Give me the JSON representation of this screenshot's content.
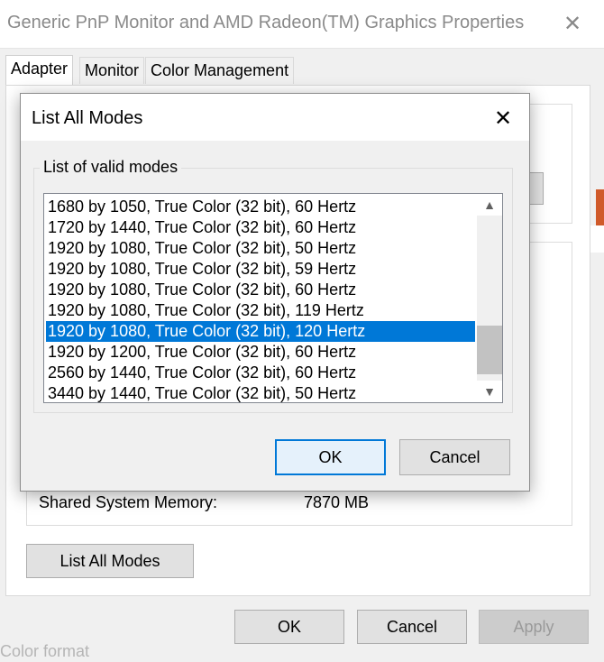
{
  "window": {
    "title": "Generic PnP Monitor and AMD Radeon(TM) Graphics Properties",
    "close_icon": "close-icon"
  },
  "tabs": [
    {
      "label": "Adapter",
      "active": true
    },
    {
      "label": "Monitor",
      "active": false
    },
    {
      "label": "Color Management",
      "active": false
    }
  ],
  "adapter": {
    "shared_memory_label": "Shared System Memory:",
    "shared_memory_value": "7870 MB",
    "list_all_modes_label": "List All Modes"
  },
  "footer": {
    "ok_label": "OK",
    "cancel_label": "Cancel",
    "apply_label": "Apply",
    "apply_enabled": false
  },
  "background_cutoff_text": "Color format",
  "dialog": {
    "title": "List All Modes",
    "group_label": "List of valid modes",
    "modes": [
      "1680 by 1050, True Color (32 bit), 60 Hertz",
      "1720 by 1440, True Color (32 bit), 60 Hertz",
      "1920 by 1080, True Color (32 bit), 50 Hertz",
      "1920 by 1080, True Color (32 bit), 59 Hertz",
      "1920 by 1080, True Color (32 bit), 60 Hertz",
      "1920 by 1080, True Color (32 bit), 119 Hertz",
      "1920 by 1080, True Color (32 bit), 120 Hertz",
      "1920 by 1200, True Color (32 bit), 60 Hertz",
      "2560 by 1440, True Color (32 bit), 60 Hertz",
      "3440 by 1440, True Color (32 bit), 50 Hertz"
    ],
    "selected_index": 6,
    "ok_label": "OK",
    "cancel_label": "Cancel",
    "selection_color": "#0078d7"
  }
}
